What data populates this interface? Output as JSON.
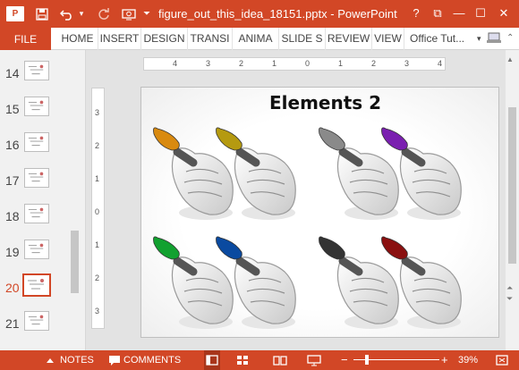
{
  "titlebar": {
    "app_logo": "P",
    "title": "figure_out_this_idea_18151.pptx - PowerPoint",
    "help": "?",
    "restore": "⧉",
    "minimize": "—",
    "maximize": "☐",
    "close": "✕"
  },
  "ribbon": {
    "file_label": "FILE",
    "tabs": [
      "HOME",
      "INSERT",
      "DESIGN",
      "TRANSI",
      "ANIMA",
      "SLIDE S",
      "REVIEW",
      "VIEW"
    ],
    "account": "Office Tut..."
  },
  "thumbnails": [
    {
      "number": "14"
    },
    {
      "number": "15"
    },
    {
      "number": "16"
    },
    {
      "number": "17"
    },
    {
      "number": "18"
    },
    {
      "number": "19"
    },
    {
      "number": "20",
      "selected": true
    },
    {
      "number": "21"
    }
  ],
  "ruler": {
    "h_labels": [
      "4",
      "3",
      "2",
      "1",
      "0",
      "1",
      "2",
      "3",
      "4"
    ],
    "v_labels": [
      "3",
      "2",
      "1",
      "0",
      "1",
      "2",
      "3"
    ]
  },
  "slide": {
    "title": "Elements 2",
    "marker_colors": [
      "#d98a10",
      "#b59a10",
      "#8a8a8a",
      "#7a1fb0",
      "#12a130",
      "#0a4aa0",
      "#333333",
      "#8a1010"
    ]
  },
  "statusbar": {
    "notes": "NOTES",
    "comments": "COMMENTS",
    "zoom": "39%",
    "zoom_minus": "−",
    "zoom_plus": "+"
  },
  "colors": {
    "accent": "#d24726"
  }
}
